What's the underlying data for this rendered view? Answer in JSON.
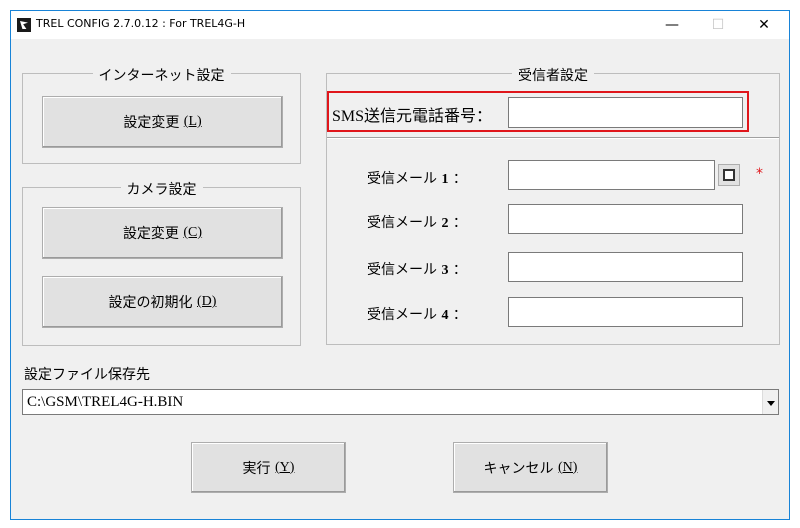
{
  "window": {
    "title": "TREL CONFIG 2.7.0.12 : For TREL4G-H"
  },
  "titlebar": {
    "minimize": "—",
    "maximize": "☐",
    "close": "✕"
  },
  "internet": {
    "legend": "インターネット設定",
    "button_label": "設定変更",
    "button_key": "(L)"
  },
  "camera": {
    "legend": "カメラ設定",
    "change_label": "設定変更",
    "change_key": "(C)",
    "init_label": "設定の初期化",
    "init_key": "(D)"
  },
  "receiver": {
    "legend": "受信者設定",
    "sms_label": "SMS送信元電話番号：",
    "sms_value": "",
    "mails": [
      {
        "label": "受信メール",
        "num": "1",
        "colon": "：",
        "value": ""
      },
      {
        "label": "受信メール",
        "num": "2",
        "colon": "：",
        "value": ""
      },
      {
        "label": "受信メール",
        "num": "3",
        "colon": "：",
        "value": ""
      },
      {
        "label": "受信メール",
        "num": "4",
        "colon": "：",
        "value": ""
      }
    ],
    "required_mark": "*",
    "checkbox_checked": false
  },
  "save": {
    "label": "設定ファイル保存先",
    "path": "C:\\GSM\\TREL4G-H.BIN"
  },
  "actions": {
    "run_label": "実行",
    "run_key": "(Y)",
    "cancel_label": "キャンセル",
    "cancel_key": "(N)"
  },
  "colors": {
    "highlight": "#e0161b",
    "title_border": "#1883d7"
  }
}
